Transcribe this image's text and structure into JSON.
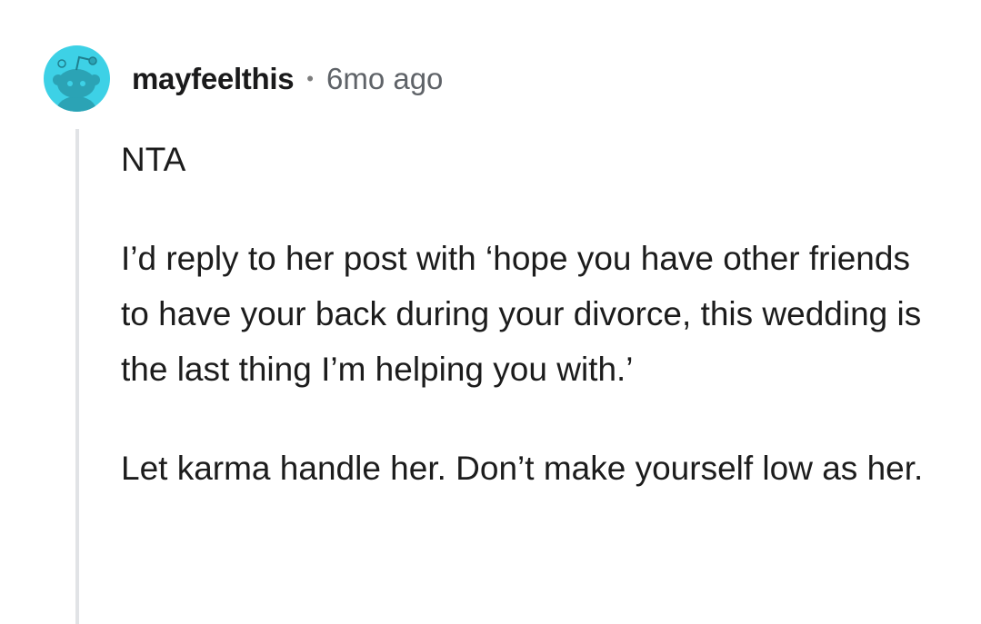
{
  "comment": {
    "avatar_icon": "reddit-snoo-icon",
    "avatar_color": "#3dd1e6",
    "username": "mayfeelthis",
    "separator": "•",
    "timestamp": "6mo ago",
    "paragraphs": [
      "NTA",
      "I’d reply to her post with ‘hope you have other friends to have your back during your divorce, this wedding is the last thing I’m helping you with.’",
      "Let karma handle her. Don’t make yourself low as her."
    ]
  }
}
